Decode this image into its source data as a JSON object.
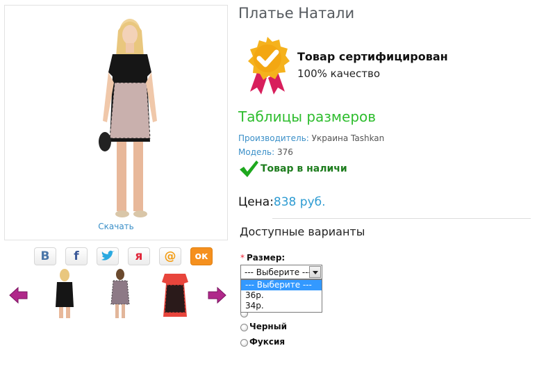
{
  "product": {
    "title": "Платье Натали",
    "download_label": "Скачать"
  },
  "certificate": {
    "title": "Товар сертифицирован",
    "subtitle": "100% качество"
  },
  "sizes_link": "Таблицы размеров",
  "manufacturer": {
    "label": "Производитель:",
    "value": "Украина Tashkan"
  },
  "model": {
    "label": "Модель:",
    "value": "376"
  },
  "stock": "Товар в наличи",
  "price": {
    "label": "Цена:",
    "value": "838 руб."
  },
  "options_heading": "Доступные варианты",
  "size_option": {
    "label": "Размер:",
    "selected": "--- Выберите ---",
    "options": [
      "--- Выберите ---",
      "36р.",
      "34р."
    ]
  },
  "color_options": [
    "Черный",
    "Фуксия"
  ],
  "colors": {
    "accent_green": "#2ebd2e",
    "link_blue": "#3a8fc8",
    "price_blue": "#2d9bd2",
    "arrow_magenta": "#b0288a"
  }
}
